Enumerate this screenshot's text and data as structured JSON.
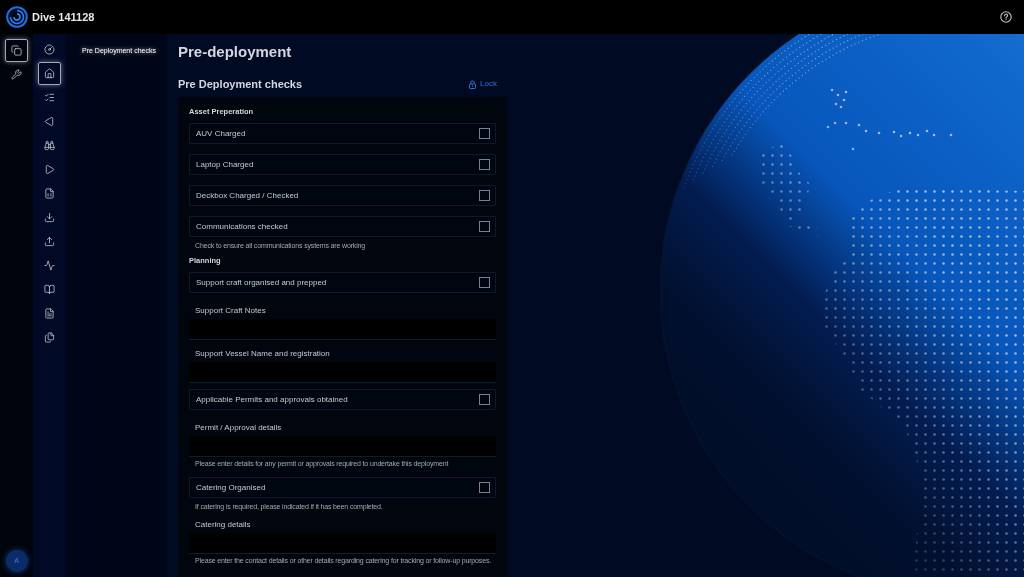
{
  "header": {
    "title": "Dive 141128"
  },
  "primary_rail": {
    "items": [
      {
        "selected": true
      },
      {
        "selected": false
      }
    ],
    "avatar": "A"
  },
  "secondary_rail": {
    "items": [
      {
        "selected": false
      },
      {
        "selected": true
      },
      {
        "selected": false
      },
      {
        "selected": false
      },
      {
        "selected": false
      },
      {
        "selected": false
      },
      {
        "selected": false
      },
      {
        "selected": false
      },
      {
        "selected": false
      },
      {
        "selected": false
      },
      {
        "selected": false
      },
      {
        "selected": false
      },
      {
        "selected": false
      }
    ]
  },
  "section_nav": {
    "items": [
      {
        "label": "Pre Deployment checks",
        "selected": true
      }
    ]
  },
  "page": {
    "title": "Pre-deployment",
    "form_title": "Pre Deployment checks",
    "lock_button": "Lock"
  },
  "form": {
    "sections": [
      {
        "title": "Asset Preperation",
        "fields": [
          {
            "kind": "checkbox",
            "label": "AUV Charged",
            "checked": false
          },
          {
            "kind": "checkbox",
            "label": "Laptop Charged",
            "checked": false
          },
          {
            "kind": "checkbox",
            "label": "Deckbox Charged / Checked",
            "checked": false
          },
          {
            "kind": "checkbox",
            "label": "Communications checked",
            "checked": false,
            "help": "Check to ensure all communications systems are working"
          }
        ]
      },
      {
        "title": "Planning",
        "fields": [
          {
            "kind": "checkbox",
            "label": "Support craft organised and prepped",
            "checked": false
          },
          {
            "kind": "text",
            "label": "Support Craft Notes"
          },
          {
            "kind": "text",
            "label": "Support Vessel Name and registration"
          },
          {
            "kind": "checkbox",
            "label": "Applicable Permits and approvals obtained",
            "checked": false
          },
          {
            "kind": "text",
            "label": "Permit / Approval details",
            "help": "Please enter details for any permit or approvals required to undertake this deployment"
          },
          {
            "kind": "checkbox",
            "label": "Catering Organised",
            "checked": false,
            "help": "If catering is required, please indicated if it has been completed."
          },
          {
            "kind": "text",
            "label": "Catering details",
            "help": "Please enter the contact details or other details regarding catering for tracking or follow-up purposes."
          }
        ]
      }
    ]
  }
}
